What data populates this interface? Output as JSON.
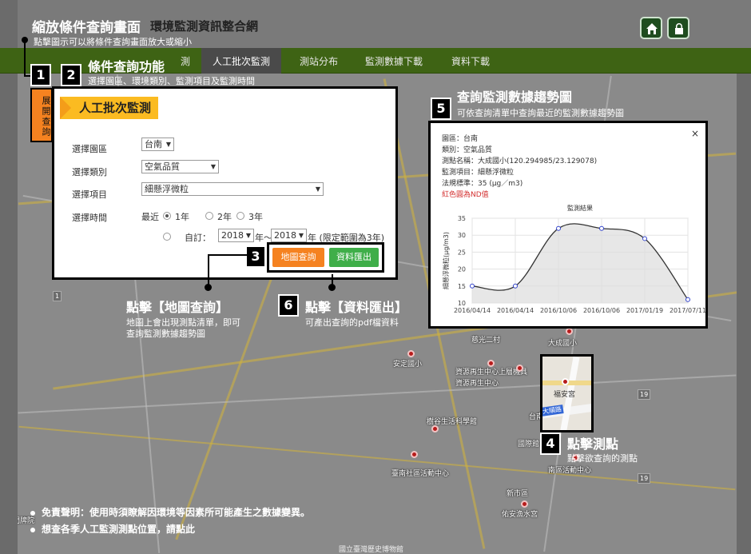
{
  "annotation_header": {
    "title": "縮放條件查詢畫面",
    "subtitle": "點擊圖示可以將條件查詢畫面放大或縮小"
  },
  "site_title": "環境監測資訊整合網",
  "header_icons": [
    "home-icon",
    "lock-icon"
  ],
  "nav": {
    "items": [
      "測",
      "人工批次監測",
      "測站分布",
      "監測數據下載",
      "資料下載"
    ],
    "active": "人工批次監測"
  },
  "annotations": {
    "n1": "1",
    "n2": {
      "num": "2",
      "title": "條件查詢功能",
      "desc": "選擇園區、環境類別、監測項目及監測時間"
    },
    "n3": "3",
    "n4": {
      "num": "4",
      "title": "點擊測點",
      "desc": "點擊欲查詢的測點"
    },
    "n5": {
      "num": "5",
      "title": "查詢監測數據趨勢圖",
      "desc": "可依查詢清單中查詢最近的監測數據趨勢圖"
    },
    "map_query": {
      "title": "點擊【地圖查詢】",
      "desc1": "地圖上會出現測點清單，即可",
      "desc2": "查詢監測數據趨勢圖"
    },
    "n6": {
      "num": "6",
      "title": "點擊【資料匯出】",
      "desc": "可產出查詢的pdf檔資料"
    }
  },
  "query_panel": {
    "tab_label": "展開查詢",
    "title": "人工批次監測",
    "park_label": "選擇園區",
    "park_value": "台南",
    "type_label": "選擇類別",
    "type_value": "空氣品質",
    "item_label": "選擇項目",
    "item_value": "細懸浮微粒",
    "time_label": "選擇時間",
    "recent_label": "最近",
    "options": [
      "1年",
      "2年",
      "3年"
    ],
    "custom_label": "自訂：",
    "year_from": "2018",
    "year_sep": "年～",
    "year_to": "2018",
    "year_suffix": "年 (限定範圍為3年)",
    "map_button": "地圖查詢",
    "export_button": "資料匯出",
    "accent": "#f58220"
  },
  "chart_popup": {
    "close": "×",
    "info": [
      "園區：台南",
      "類別：空氣品質",
      "測點名稱：大成國小(120.294985/23.129078)",
      "監測項目：細懸浮微粒",
      "法規標準：35 (μg／m3)"
    ],
    "nd_note": "紅色圓為ND值"
  },
  "chart_data": {
    "type": "line",
    "title": "監測結果",
    "xlabel": "",
    "ylabel": "細懸浮微粒(μg/m3)",
    "ylim": [
      10,
      35
    ],
    "yticks": [
      10,
      15,
      20,
      25,
      30,
      35
    ],
    "x": [
      "2016/04/14",
      "2016/04/14",
      "2016/10/06",
      "2016/10/06",
      "2017/01/19",
      "2017/07/11"
    ],
    "series": [
      {
        "values": [
          15,
          15,
          32,
          32,
          29,
          11
        ]
      }
    ],
    "grid": true,
    "line_color": "#333333",
    "point_color": "#3344cc",
    "fill_color": "#dddddd"
  },
  "station": {
    "name": "福安宮",
    "street": "大順路"
  },
  "map": {
    "labels": [
      "安定國小",
      "資源再生中心上層機具",
      "資源再生中心",
      "樹谷生活科學館",
      "台南大學",
      "大成國小",
      "慈光二村",
      "國際館",
      "臺南社區活動中心",
      "南區活動中心",
      "新市區",
      "佑安漁水宮",
      "國立臺灣歷史博物館",
      "門牌院"
    ],
    "highways": [
      "1",
      "19",
      "19",
      "1"
    ]
  },
  "footnotes": [
    "免責聲明：使用時須瞭解因環境等因素所可能產生之數據變異。",
    "想查各季人工監測測點位置，請點此"
  ]
}
